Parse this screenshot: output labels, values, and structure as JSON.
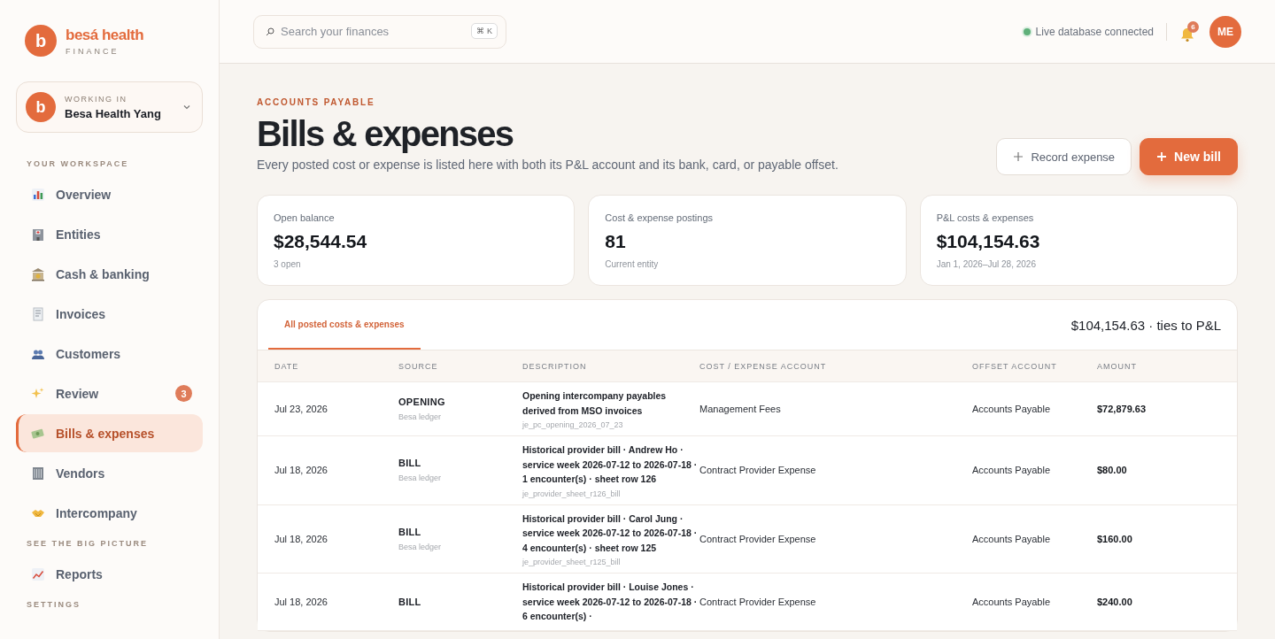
{
  "brand": {
    "logo_letter": "b",
    "name": "besá health",
    "subtitle": "FINANCE"
  },
  "workspace": {
    "letter": "b",
    "label": "WORKING IN",
    "name": "Besa Health Yang"
  },
  "sidebar": {
    "sections": [
      {
        "title": "YOUR WORKSPACE",
        "items": [
          {
            "label": "Overview",
            "selected": false
          },
          {
            "label": "Entities",
            "selected": false
          },
          {
            "label": "Cash & banking",
            "selected": false
          },
          {
            "label": "Invoices",
            "selected": false
          },
          {
            "label": "Customers",
            "selected": false
          },
          {
            "label": "Review",
            "selected": false,
            "badge": "3"
          },
          {
            "label": "Bills & expenses",
            "selected": true
          },
          {
            "label": "Vendors",
            "selected": false
          },
          {
            "label": "Intercompany",
            "selected": false
          }
        ]
      },
      {
        "title": "SEE THE BIG PICTURE",
        "items": [
          {
            "label": "Reports",
            "selected": false
          }
        ]
      },
      {
        "title": "SETTINGS"
      }
    ]
  },
  "topbar": {
    "search": {
      "placeholder": "Search your finances",
      "shortcut": "⌘ K"
    },
    "status": "Live database connected",
    "notifications": "6",
    "avatar": "ME"
  },
  "header": {
    "eyebrow": "ACCOUNTS PAYABLE",
    "title": "Bills & expenses",
    "description": "Every posted cost or expense is listed here with both its P&L account and its bank, card, or payable offset.",
    "buttons": [
      {
        "label": "Record expense",
        "kind": "secondary"
      },
      {
        "label": "New bill",
        "kind": "primary"
      }
    ]
  },
  "stats": [
    {
      "label": "Open balance",
      "value": "$28,544.54",
      "note": "3 open"
    },
    {
      "label": "Cost & expense postings",
      "value": "81",
      "note": "Current entity"
    },
    {
      "label": "P&L costs & expenses",
      "value": "$104,154.63",
      "note": "Jan 1, 2026–Jul 28, 2026"
    }
  ],
  "table": {
    "tabs": [
      {
        "label": "All posted costs & expenses",
        "selected": true
      }
    ],
    "total": "$104,154.63 · ties to P&L",
    "columns": [
      "DATE",
      "SOURCE",
      "DESCRIPTION",
      "COST / EXPENSE ACCOUNT",
      "OFFSET ACCOUNT",
      "AMOUNT"
    ],
    "rows": [
      {
        "date": "Jul 23, 2026",
        "source": "OPENING",
        "ledger": "Besa ledger",
        "description": "Opening intercompany payables derived from MSO invoices",
        "ref": "je_pc_opening_2026_07_23",
        "account": "Management Fees",
        "offset": "Accounts Payable",
        "amount": "$72,879.63"
      },
      {
        "date": "Jul 18, 2026",
        "source": "BILL",
        "ledger": "Besa ledger",
        "description": "Historical provider bill · Andrew Ho · service week 2026-07-12 to 2026-07-18 · 1 encounter(s) · sheet row 126",
        "ref": "je_provider_sheet_r126_bill",
        "account": "Contract Provider Expense",
        "offset": "Accounts Payable",
        "amount": "$80.00"
      },
      {
        "date": "Jul 18, 2026",
        "source": "BILL",
        "ledger": "Besa ledger",
        "description": "Historical provider bill · Carol Jung · service week 2026-07-12 to 2026-07-18 · 4 encounter(s) · sheet row 125",
        "ref": "je_provider_sheet_r125_bill",
        "account": "Contract Provider Expense",
        "offset": "Accounts Payable",
        "amount": "$160.00"
      },
      {
        "date": "Jul 18, 2026",
        "source": "BILL",
        "description": "Historical provider bill · Louise Jones · service week 2026-07-12 to 2026-07-18 · 6 encounter(s) ·",
        "account": "Contract Provider Expense",
        "offset": "Accounts Payable",
        "amount": "$240.00"
      }
    ]
  }
}
